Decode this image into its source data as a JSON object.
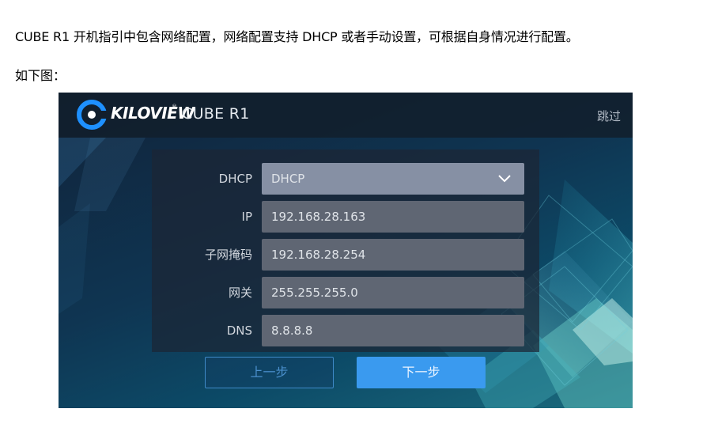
{
  "document": {
    "intro": "CUBE R1 开机指引中包含网络配置，网络配置支持 DHCP 或者手动设置，可根据自身情况进行配置。",
    "caption": "如下图："
  },
  "app": {
    "brand": "KILOVIEW",
    "brand_mark": "®",
    "product": "CUBE R1",
    "skip_label": "跳过"
  },
  "form": {
    "fields": [
      {
        "label": "DHCP",
        "value": "DHCP",
        "type": "select"
      },
      {
        "label": "IP",
        "value": "192.168.28.163",
        "type": "text"
      },
      {
        "label": "子网掩码",
        "value": "192.168.28.254",
        "type": "text"
      },
      {
        "label": "网关",
        "value": "255.255.255.0",
        "type": "text"
      },
      {
        "label": "DNS",
        "value": "8.8.8.8",
        "type": "text"
      }
    ]
  },
  "buttons": {
    "prev_label": "上一步",
    "next_label": "下一步"
  },
  "colors": {
    "accent": "#3a9aef",
    "logo_blue": "#1e90ff",
    "field_bg": "#5f6673",
    "select_bg": "#8690a4"
  },
  "icons": {
    "logo": "kiloview-logo-icon",
    "dropdown": "chevron-down-icon"
  }
}
